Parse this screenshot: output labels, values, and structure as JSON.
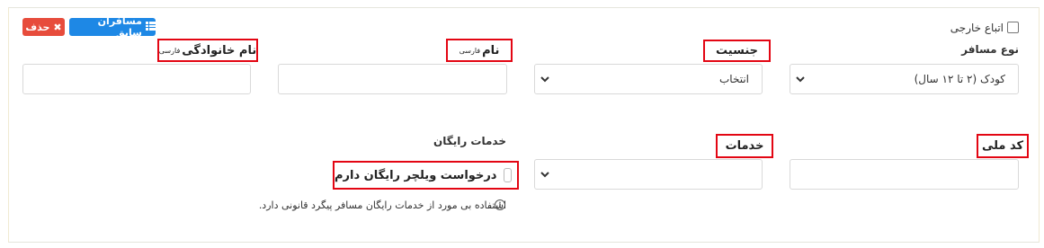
{
  "toolbar": {
    "delete_label": "حذف",
    "previous_passengers_label": "مسافران سابق"
  },
  "foreign_nationals": {
    "label": "اتباع خارجی",
    "checked": false
  },
  "passenger_type": {
    "label": "نوع مسافر",
    "value": "کودک (۲ تا ۱۲ سال)"
  },
  "gender": {
    "label": "جنسیت",
    "value": "انتخاب"
  },
  "first_name": {
    "label": "نام",
    "superscript": "فارسی",
    "value": ""
  },
  "last_name": {
    "label": "نام خانوادگی",
    "superscript": "فارسی",
    "value": ""
  },
  "national_code": {
    "label": "کد ملی",
    "value": ""
  },
  "services": {
    "label": "خدمات",
    "value": ""
  },
  "free_services": {
    "label": "خدمات رایگان",
    "wheelchair_label": "درخواست ویلچر رایگان دارم",
    "wheelchair_checked": false,
    "note": "استفاده بی مورد از خدمات رایگان مسافر پیگرد قانونی دارد."
  },
  "colors": {
    "highlight_border": "#e30613",
    "delete_button": "#e74c3c",
    "primary_button": "#1e88e5"
  }
}
